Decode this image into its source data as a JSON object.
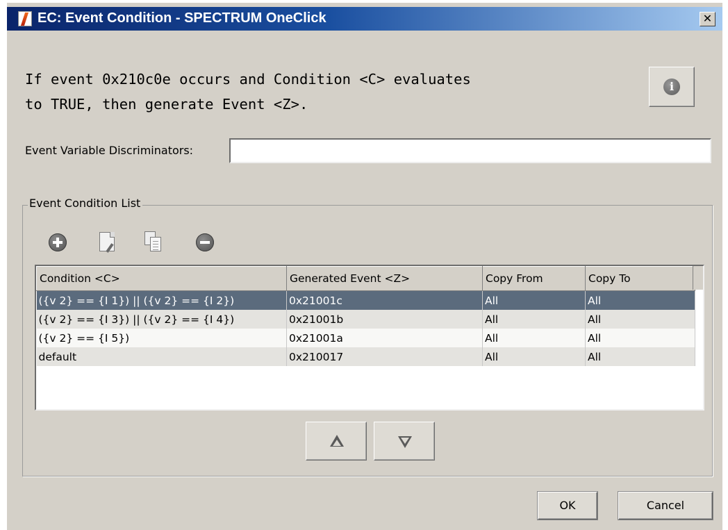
{
  "window": {
    "title": "EC: Event Condition - SPECTRUM OneClick",
    "close_glyph": "✕"
  },
  "header": {
    "description": "If event 0x210c0e occurs and Condition <C> evaluates\nto TRUE, then generate Event <Z>.",
    "info_icon": "info-icon",
    "info_glyph": "i"
  },
  "discriminators": {
    "label": "Event Variable Discriminators:",
    "value": ""
  },
  "condition_list": {
    "legend": "Event Condition List",
    "toolbar": {
      "add_icon": "add-circle-icon",
      "edit_icon": "edit-document-icon",
      "copy_icon": "copy-icon",
      "remove_icon": "remove-circle-icon"
    },
    "columns": [
      "Condition <C>",
      "Generated Event <Z>",
      "Copy From",
      "Copy To"
    ],
    "rows": [
      {
        "condition": "({v 2} == {I 1}) || ({v 2} == {I 2})",
        "event": "0x21001c",
        "copy_from": "All",
        "copy_to": "All",
        "selected": true
      },
      {
        "condition": "({v 2} == {I 3}) || ({v 2} == {I 4})",
        "event": "0x21001b",
        "copy_from": "All",
        "copy_to": "All",
        "selected": false
      },
      {
        "condition": "({v 2} == {I 5})",
        "event": "0x21001a",
        "copy_from": "All",
        "copy_to": "All",
        "selected": false
      },
      {
        "condition": "default",
        "event": "0x210017",
        "copy_from": "All",
        "copy_to": "All",
        "selected": false
      }
    ],
    "move_up_icon": "triangle-up-icon",
    "move_down_icon": "triangle-down-icon"
  },
  "buttons": {
    "ok": "OK",
    "cancel": "Cancel"
  },
  "colors": {
    "title_gradient_start": "#0a246a",
    "title_gradient_end": "#a6caf0",
    "dialog_background": "#d4d0c8",
    "selected_row": "#5b6b7d"
  }
}
